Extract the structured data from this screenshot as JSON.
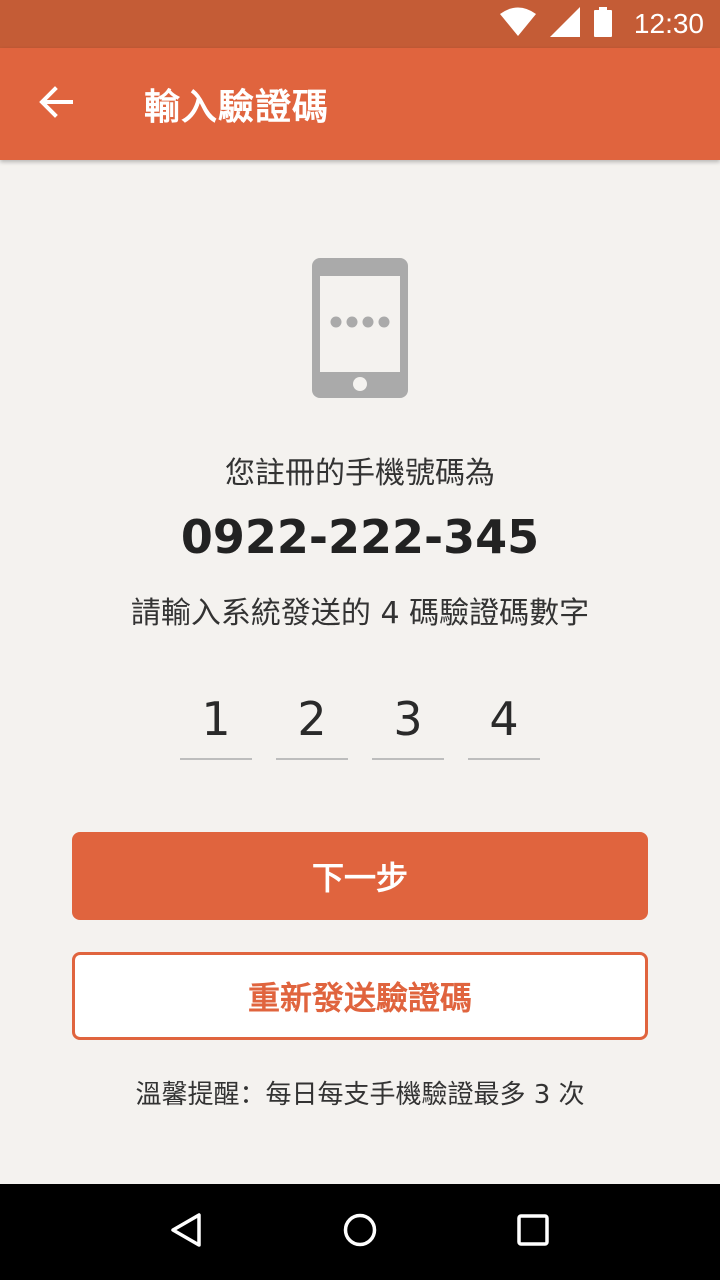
{
  "status_bar": {
    "time": "12:30",
    "icons": [
      "wifi-icon",
      "signal-icon",
      "battery-icon"
    ]
  },
  "app_bar": {
    "title": "輸入驗證碼",
    "back_icon": "arrow-left-icon"
  },
  "illustration": {
    "icon": "phone-message-icon"
  },
  "content": {
    "registered_label": "您註冊的手機號碼為",
    "phone_number": "0922-222-345",
    "instruction": "請輸入系統發送的 4 碼驗證碼數字",
    "code_digits": [
      "1",
      "2",
      "3",
      "4"
    ]
  },
  "actions": {
    "next_label": "下一步",
    "resend_label": "重新發送驗證碼"
  },
  "reminder": "溫馨提醒：每日每支手機驗證最多 3 次",
  "nav_bar": {
    "icons": [
      "back-triangle-icon",
      "home-circle-icon",
      "recents-square-icon"
    ]
  },
  "colors": {
    "primary": "#e0643e",
    "status_bar": "#c45c36",
    "background": "#f4f2ef",
    "illustration_gray": "#aaaaaa"
  }
}
